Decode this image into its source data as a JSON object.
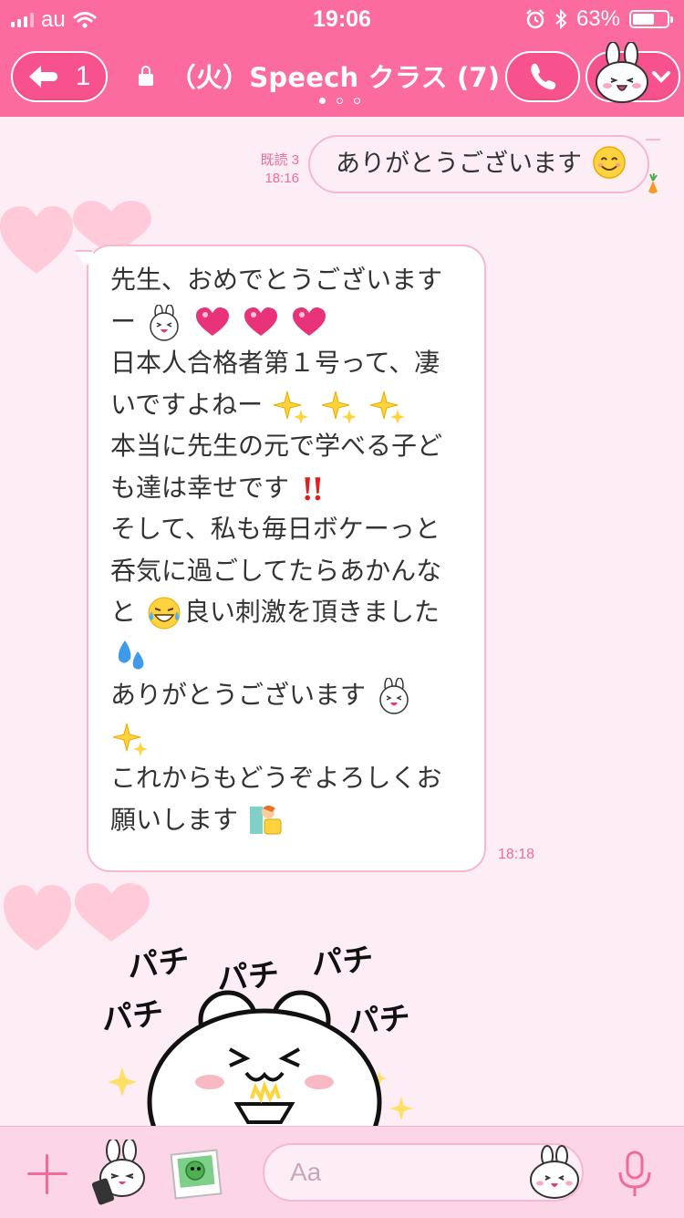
{
  "status_bar": {
    "carrier": "au",
    "time": "19:06",
    "battery": "63%",
    "battery_level": 0.63
  },
  "header": {
    "back_count": "1",
    "title": "（火）Speech クラス (7)",
    "page_dots": 3,
    "active_dot": 0
  },
  "messages": {
    "outgoing": {
      "read_receipt": "既読 3",
      "time": "18:16",
      "text": "ありがとうございます"
    },
    "incoming": {
      "time": "18:18",
      "lines": [
        "先生、おめでとうございます",
        "ー",
        "日本人合格者第１号って、凄",
        "いですよねー",
        "本当に先生の元で学べる子ど",
        "も達は幸せです",
        "そして、私も毎日ボケーっと",
        "呑気に過ごしてたらあかんな",
        "と",
        "良い刺激を頂きました",
        "ありがとうございます",
        "これからもどうぞよろしくお",
        "願いします"
      ]
    },
    "sticker": {
      "words": [
        "パチ",
        "パチ",
        "パチ",
        "パチ",
        "パチ"
      ]
    }
  },
  "input_bar": {
    "placeholder": "Aa"
  },
  "colors": {
    "header_pink": "#fb6b9e",
    "background": "#fdeef5",
    "accent": "#f06b9a"
  }
}
